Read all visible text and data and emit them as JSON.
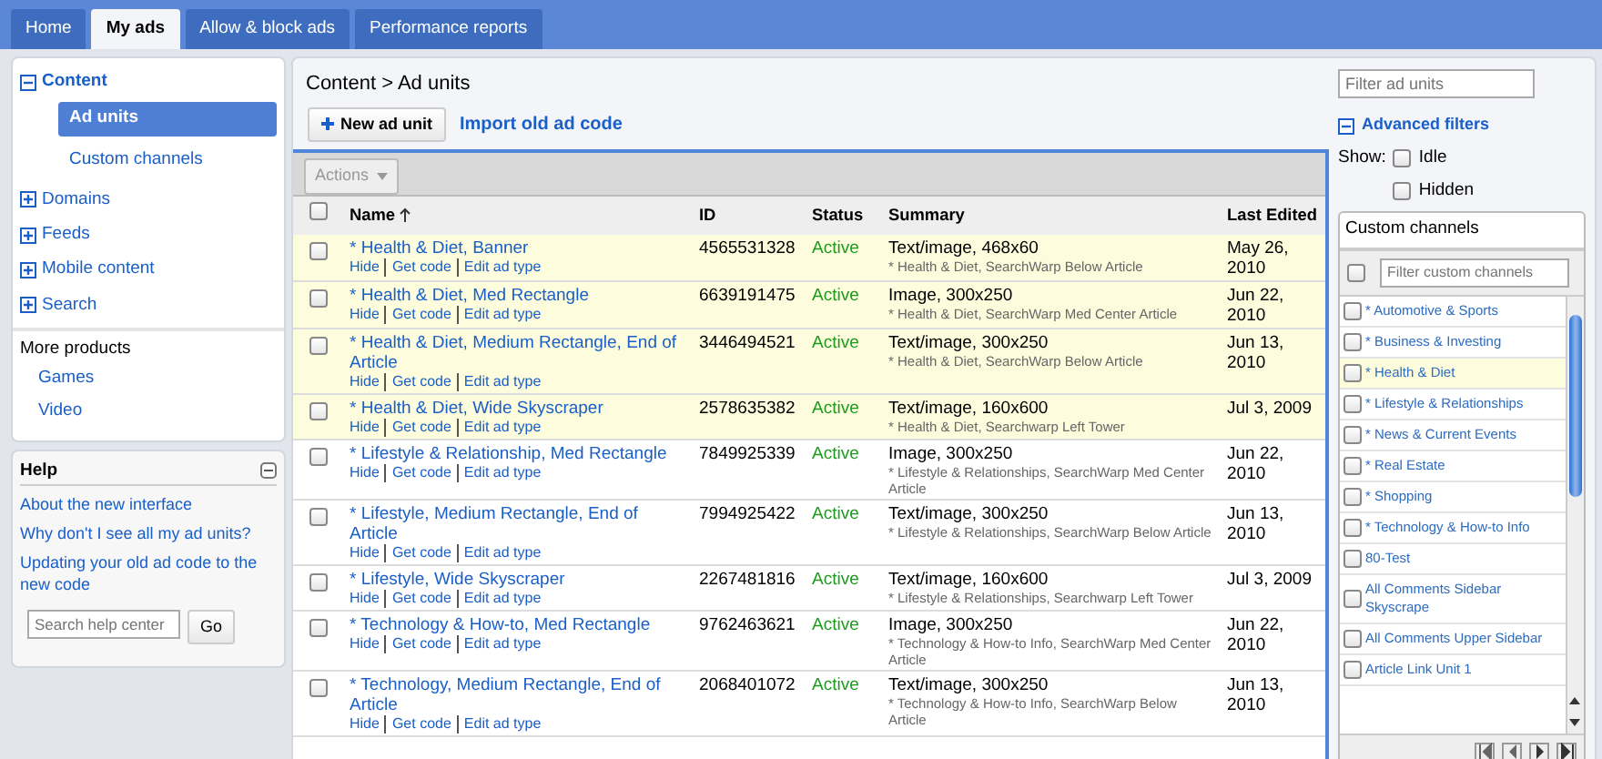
{
  "tabs": [
    {
      "label": "Home",
      "selected": false
    },
    {
      "label": "My ads",
      "selected": true
    },
    {
      "label": "Allow & block ads",
      "selected": false
    },
    {
      "label": "Performance reports",
      "selected": false
    }
  ],
  "sidebar": {
    "items": [
      {
        "label": "Content",
        "expanded": true,
        "children": [
          {
            "label": "Ad units",
            "selected": true
          },
          {
            "label": "Custom channels",
            "selected": false
          }
        ]
      },
      {
        "label": "Domains",
        "expanded": false
      },
      {
        "label": "Feeds",
        "expanded": false
      },
      {
        "label": "Mobile content",
        "expanded": false
      },
      {
        "label": "Search",
        "expanded": false
      }
    ],
    "more_products": {
      "title": "More products",
      "items": [
        "Games",
        "Video"
      ]
    }
  },
  "help": {
    "title": "Help",
    "links": [
      "About the new interface",
      "Why don't I see all my ad units?",
      "Updating your old ad code to the new code"
    ],
    "search": {
      "placeholder": "Search help center"
    },
    "button": "Go"
  },
  "breadcrumb": "Content > Ad units",
  "new_button": "New ad unit",
  "import_link": "Import old ad code",
  "actions": {
    "label": "Actions",
    "disabled": true
  },
  "table": {
    "header_checked": false,
    "columns": [
      "Name",
      "ID",
      "Status",
      "Summary",
      "Last Edited"
    ],
    "rows": [
      {
        "name": "* Health & Diet, Banner",
        "actions": [
          "Hide",
          "Get code",
          "Edit ad type"
        ],
        "id": "4565531328",
        "status": "Active",
        "summary": "Text/image, 468x60",
        "detail": "* Health & Diet, SearchWarp Below Article",
        "edited": "May 26, 2010",
        "highlighted": true,
        "checked": false
      },
      {
        "name": "* Health & Diet, Med Rectangle",
        "actions": [
          "Hide",
          "Get code",
          "Edit ad type"
        ],
        "id": "6639191475",
        "status": "Active",
        "summary": "Image, 300x250",
        "detail": "* Health & Diet, SearchWarp Med Center Article",
        "edited": "Jun 22, 2010",
        "highlighted": true,
        "checked": false
      },
      {
        "name": "* Health & Diet, Medium Rectangle, End of Article",
        "actions": [
          "Hide",
          "Get code",
          "Edit ad type"
        ],
        "id": "3446494521",
        "status": "Active",
        "summary": "Text/image, 300x250",
        "detail": "* Health & Diet, SearchWarp Below Article",
        "edited": "Jun 13, 2010",
        "highlighted": true,
        "checked": false
      },
      {
        "name": "* Health & Diet, Wide Skyscraper",
        "actions": [
          "Hide",
          "Get code",
          "Edit ad type"
        ],
        "id": "2578635382",
        "status": "Active",
        "summary": "Text/image, 160x600",
        "detail": "* Health & Diet, Searchwarp Left Tower",
        "edited": "Jul 3, 2009",
        "highlighted": true,
        "checked": false
      },
      {
        "name": "* Lifestyle & Relationship, Med Rectangle",
        "actions": [
          "Hide",
          "Get code",
          "Edit ad type"
        ],
        "id": "7849925339",
        "status": "Active",
        "summary": "Image, 300x250",
        "detail": "* Lifestyle & Relationships, SearchWarp Med Center Article",
        "edited": "Jun 22, 2010",
        "highlighted": false,
        "checked": false
      },
      {
        "name": "* Lifestyle, Medium Rectangle, End of Article",
        "actions": [
          "Hide",
          "Get code",
          "Edit ad type"
        ],
        "id": "7994925422",
        "status": "Active",
        "summary": "Text/image, 300x250",
        "detail": "* Lifestyle & Relationships, SearchWarp Below Article",
        "edited": "Jun 13, 2010",
        "highlighted": false,
        "checked": false
      },
      {
        "name": "* Lifestyle, Wide Skyscraper",
        "actions": [
          "Hide",
          "Get code",
          "Edit ad type"
        ],
        "id": "2267481816",
        "status": "Active",
        "summary": "Text/image, 160x600",
        "detail": "* Lifestyle & Relationships, Searchwarp Left Tower",
        "edited": "Jul 3, 2009",
        "highlighted": false,
        "checked": false
      },
      {
        "name": "* Technology & How-to, Med Rectangle",
        "actions": [
          "Hide",
          "Get code",
          "Edit ad type"
        ],
        "id": "9762463621",
        "status": "Active",
        "summary": "Image, 300x250",
        "detail": "* Technology & How-to Info, SearchWarp Med Center Article",
        "edited": "Jun 22, 2010",
        "highlighted": false,
        "checked": false
      },
      {
        "name": "* Technology, Medium Rectangle, End of Article",
        "actions": [
          "Hide",
          "Get code",
          "Edit ad type"
        ],
        "id": "2068401072",
        "status": "Active",
        "summary": "Text/image, 300x250",
        "detail": "* Technology & How-to Info, SearchWarp Below Article",
        "edited": "Jun 13, 2010",
        "highlighted": false,
        "checked": false
      }
    ]
  },
  "filters": {
    "search": {
      "placeholder": "Filter ad units"
    },
    "advanced": {
      "label": "Advanced filters",
      "expanded": true
    },
    "show_label": "Show:",
    "show": [
      {
        "label": "Idle",
        "checked": false
      },
      {
        "label": "Hidden",
        "checked": false
      }
    ],
    "channels": {
      "title": "Custom channels",
      "all_checked": false,
      "search": {
        "placeholder": "Filter custom channels"
      },
      "items": [
        {
          "label": "* Automotive & Sports",
          "selected": false,
          "checked": false
        },
        {
          "label": "* Business & Investing",
          "selected": false,
          "checked": false
        },
        {
          "label": "* Health & Diet",
          "selected": true,
          "checked": false
        },
        {
          "label": "* Lifestyle & Relationships",
          "selected": false,
          "checked": false
        },
        {
          "label": "* News & Current Events",
          "selected": false,
          "checked": false
        },
        {
          "label": "* Real Estate",
          "selected": false,
          "checked": false
        },
        {
          "label": "* Shopping",
          "selected": false,
          "checked": false
        },
        {
          "label": "* Technology & How-to Info",
          "selected": false,
          "checked": false
        },
        {
          "label": "80-Test",
          "selected": false,
          "checked": false
        },
        {
          "label": "All Comments Sidebar Skyscrape",
          "selected": false,
          "checked": false
        },
        {
          "label": "All Comments Upper Sidebar",
          "selected": false,
          "checked": false
        },
        {
          "label": "Article Link Unit 1",
          "selected": false,
          "checked": false
        }
      ]
    }
  }
}
